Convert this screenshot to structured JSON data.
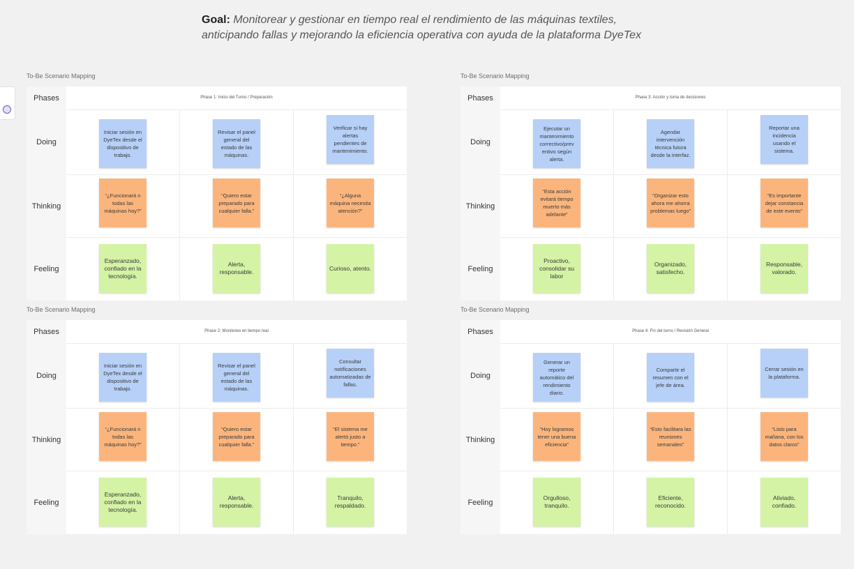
{
  "goal": {
    "label": "Goal:",
    "line1": "Monitorear y gestionar en tiempo real el rendimiento de las máquinas textiles,",
    "line2": "anticipando fallas y mejorando la eficiencia operativa con ayuda de la plataforma DyeTex"
  },
  "row_labels": {
    "phases": "Phases",
    "doing": "Doing",
    "thinking": "Thinking",
    "feeling": "Feeling"
  },
  "colors": {
    "doing": "#b6d0f8",
    "thinking": "#fbb57c",
    "feeling": "#d4f3a4",
    "canvas": "#f1f1f1"
  },
  "boards": [
    {
      "title": "To-Be Scenario Mapping",
      "phase": "Phase 1: Inicio del Turno / Preparación",
      "doing": [
        "Iniciar sesión en DyeTex desde el dispositivo de trabajo.",
        "Revisar el panel general del estado de las máquinas.",
        "Verificar si hay alertas pendientes de mantenimiento."
      ],
      "thinking": [
        "“¿Funcionará n todas las máquinas hoy?”",
        "“Quiero estar preparado para cualquier falla.”",
        "“¿Alguna máquina necesita atención?”"
      ],
      "feeling": [
        "Esperanzado, confiado en la tecnología.",
        "Alerta, responsable.",
        "Curioso, atento."
      ]
    },
    {
      "title": "To-Be Scenario Mapping",
      "phase": "Phase 3: Acción y toma de decisiones",
      "doing": [
        "Ejecutar un mantenimiento correctivo/prev entivo según alerta.",
        "Agendar intervención técnica futura desde la interfaz.",
        "Reportar una incidencia usando el sistema."
      ],
      "thinking": [
        "“Esta acción evitará tiempo muerto más adelante”",
        "“Organizar esto ahora me ahorra problemas luego”",
        "“Es importante dejar constancia de este evento”"
      ],
      "feeling": [
        "Proactivo, consolidar su labor",
        "Organizado, satisfecho.",
        "Responsable, valorado."
      ]
    },
    {
      "title": "To-Be Scenario Mapping",
      "phase": "Phase 2: Monitoreo en tiempo real",
      "doing": [
        "Iniciar sesión en DyeTex desde el dispositivo de trabajo.",
        "Revisar el panel general del estado de las máquinas.",
        "Consultar notificaciones automatizadas de fallas."
      ],
      "thinking": [
        "“¿Funcionará n todas las máquinas hoy?”",
        "“Quiero estar preparado para cualquier falla.”",
        "“El sistema me alertó justo a tiempo.”"
      ],
      "feeling": [
        "Esperanzado, confiado en la tecnología.",
        "Alerta, responsable.",
        "Tranquilo, respaldado."
      ]
    },
    {
      "title": "To-Be Scenario Mapping",
      "phase": "Phase 4: Fin del turno / Revisión General",
      "doing": [
        "Generar un reporte automático del rendimiento diario.",
        "Compartir el resumen con el jefe de área.",
        "Cerrar sesión en la plataforma."
      ],
      "thinking": [
        "“Hoy logramos tener una buena eficiencia”",
        "“Esto facilitara las reuniones semanales”",
        "“Listo para mañana, con los datos claros”"
      ],
      "feeling": [
        "Orgulloso, tranquilo.",
        "Eficiente, reconocido.",
        "Aliviado, confiado."
      ]
    }
  ]
}
